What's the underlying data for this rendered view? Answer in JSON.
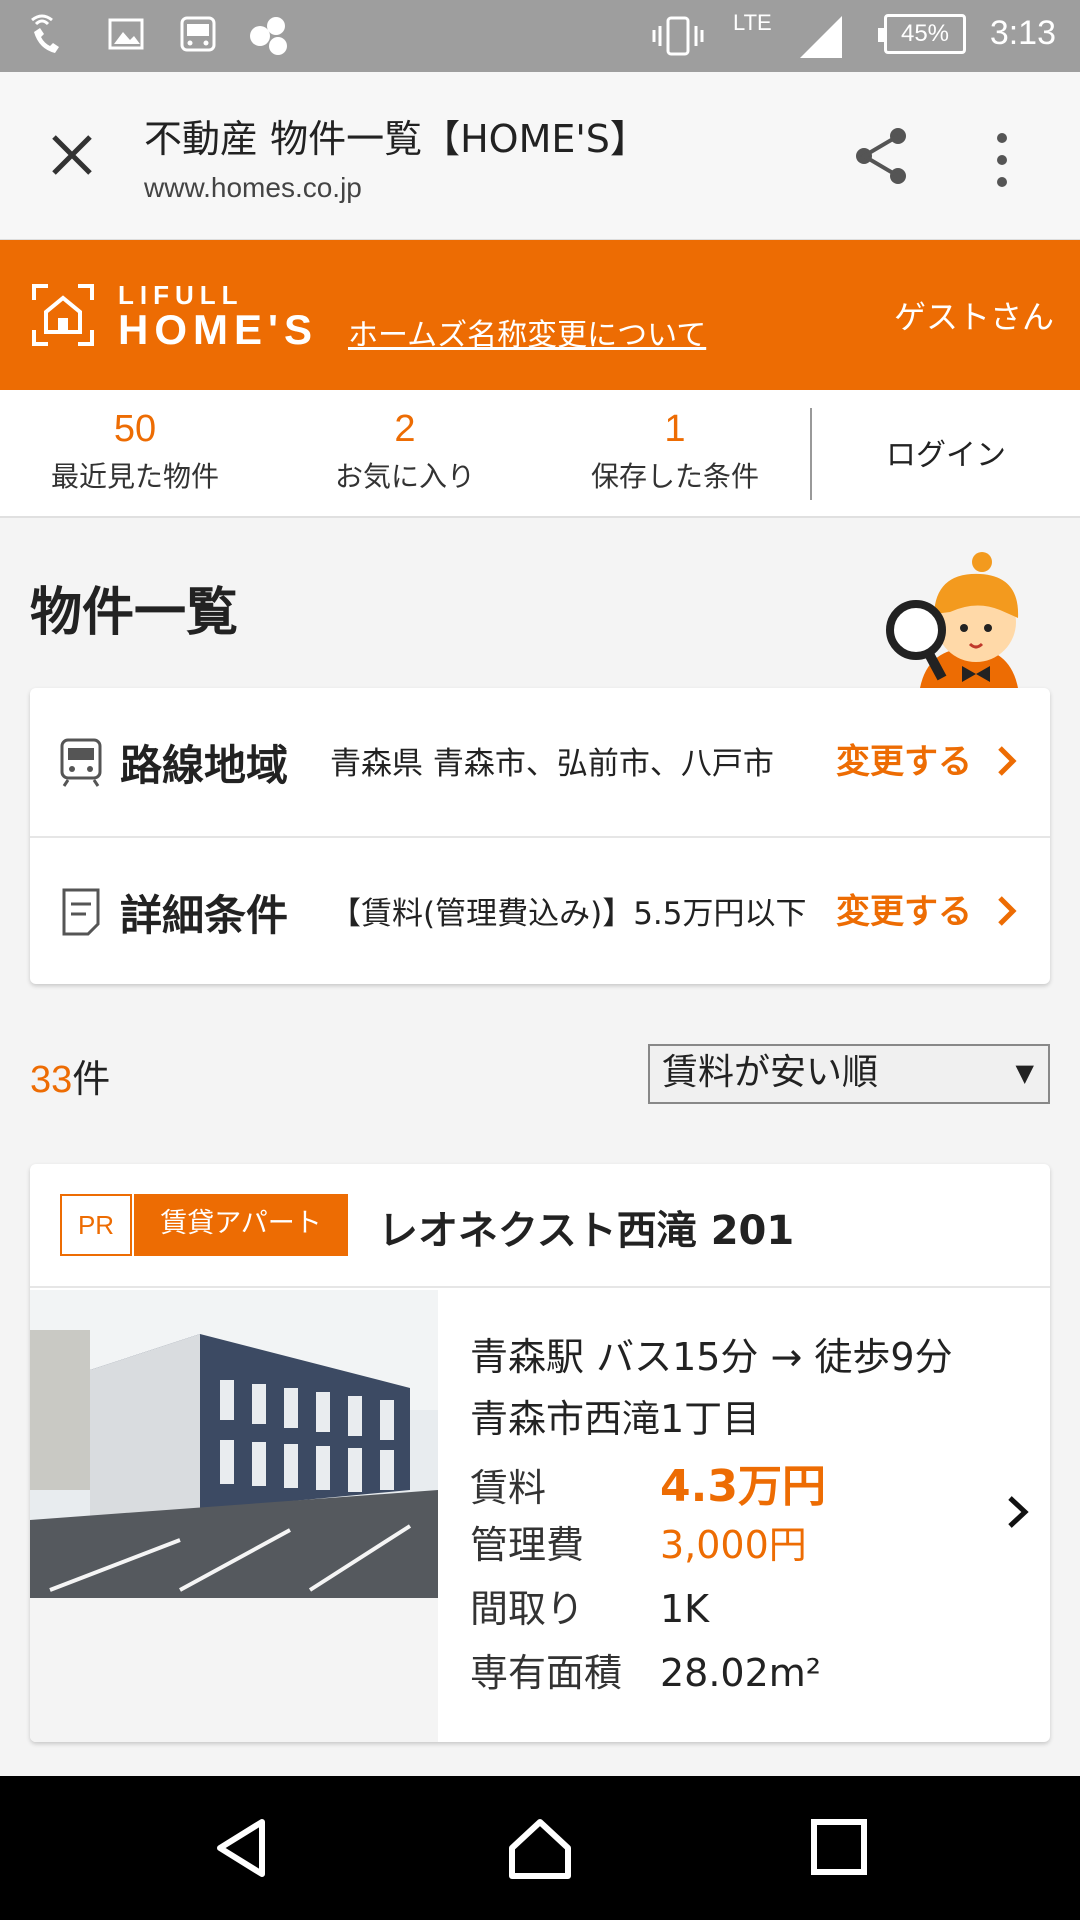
{
  "status_bar": {
    "network": "LTE",
    "battery": "45%",
    "time": "3:13"
  },
  "browser": {
    "title": "不動産 物件一覧【HOME'S】",
    "url": "www.homes.co.jp"
  },
  "header": {
    "logo_top": "LIFULL",
    "logo_main": "HOME'S",
    "rename_link": "ホームズ名称変更について",
    "guest": "ゲストさん"
  },
  "counters": {
    "recent": {
      "count": "50",
      "label": "最近見た物件"
    },
    "favorites": {
      "count": "2",
      "label": "お気に入り"
    },
    "saved": {
      "count": "1",
      "label": "保存した条件"
    },
    "login": "ログイン"
  },
  "page": {
    "title": "物件一覧"
  },
  "conditions": {
    "route": {
      "label": "路線地域",
      "value": "青森県 青森市、弘前市、八戸市",
      "button": "変更する"
    },
    "detail": {
      "label": "詳細条件",
      "value": "【賃料(管理費込み)】5.5万円以下",
      "button": "変更する"
    }
  },
  "results": {
    "count": "33",
    "unit": "件",
    "sort_selected": "賃料が安い順"
  },
  "property": {
    "pr": "PR",
    "type": "賃貸アパート",
    "name": "レオネクスト西滝 201",
    "access": "青森駅 バス15分 → 徒歩9分",
    "address": "青森市西滝1丁目",
    "rent_label": "賃料",
    "rent_value": "4.3万円",
    "fee_label": "管理費",
    "fee_value": "3,000円",
    "layout_label": "間取り",
    "layout_value": "1K",
    "area_label": "専有面積",
    "area_value": "28.02m²"
  },
  "colors": {
    "accent": "#ed6c03",
    "status_bar": "#9e9e9e",
    "nav_bar": "#000000"
  }
}
